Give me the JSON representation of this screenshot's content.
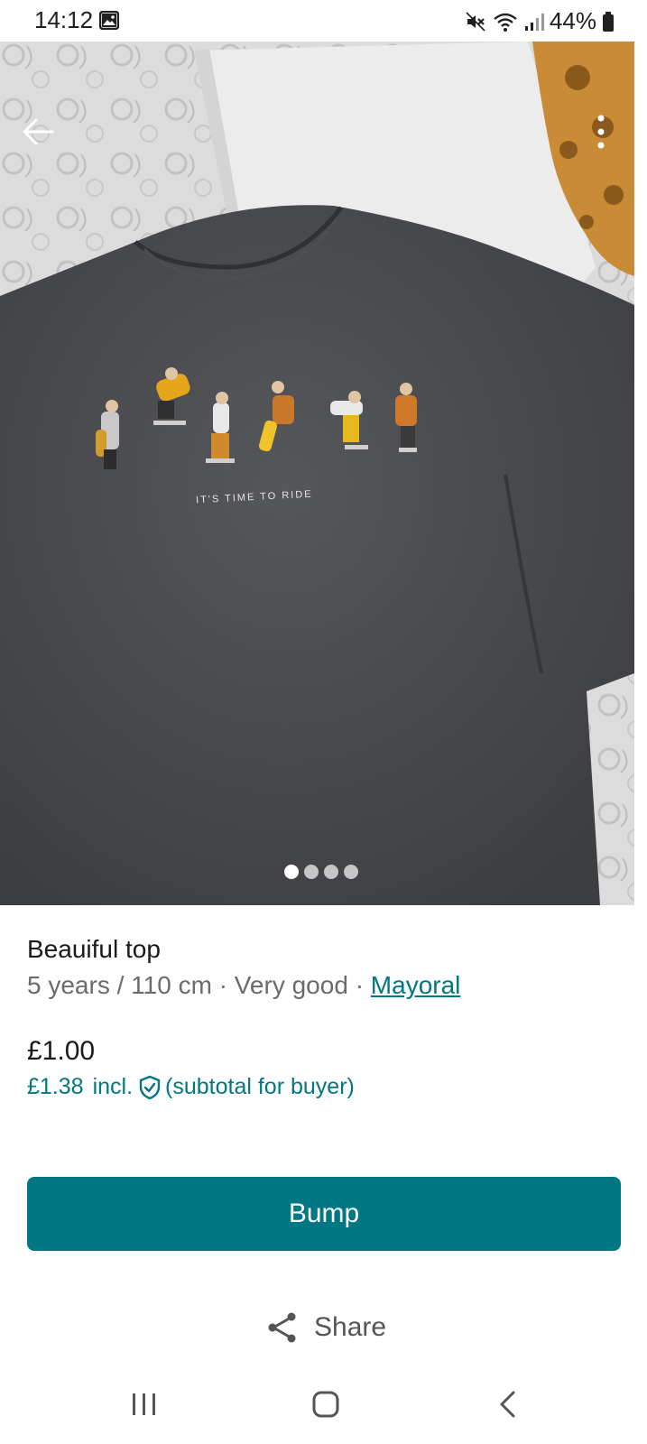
{
  "status_bar": {
    "time": "14:12",
    "battery": "44%",
    "icons": [
      "gallery-icon",
      "mute-icon",
      "wifi-icon",
      "signal-icon",
      "battery-icon"
    ]
  },
  "photo": {
    "print_text": "IT'S TIME TO RIDE",
    "image_count": 4,
    "active_index": 0,
    "icons": [
      "back-arrow-icon",
      "more-vertical-icon"
    ]
  },
  "product": {
    "title": "Beauiful top",
    "size": "5 years / 110 cm",
    "separator": "·",
    "condition": "Very good",
    "brand": "Mayoral",
    "price": "£1.00",
    "buyer_price": "£1.38",
    "incl": "incl.",
    "buyer_note": "(subtotal for buyer)"
  },
  "actions": {
    "bump_label": "Bump",
    "share_label": "Share"
  },
  "colors": {
    "accent": "#007782",
    "text": "#1a1a1a",
    "muted": "#6b6b6b"
  },
  "nav_bar": {
    "icons": [
      "recents-icon",
      "home-icon",
      "back-icon"
    ]
  }
}
